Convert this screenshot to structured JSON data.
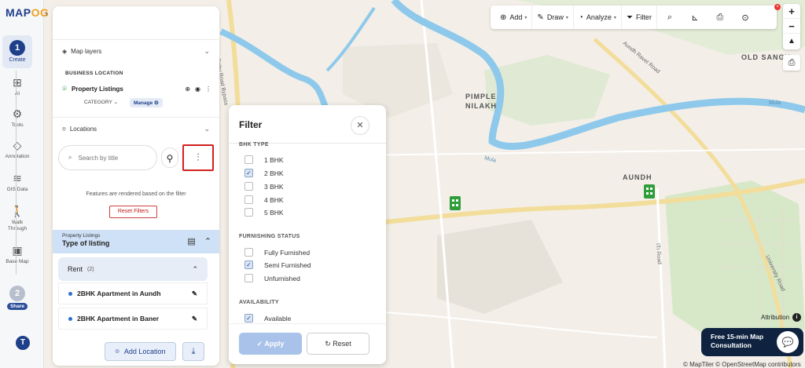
{
  "app": {
    "logo_text": "MAP",
    "logo_accent": "OG"
  },
  "rail": {
    "items": [
      {
        "label": "Create",
        "step": "1"
      },
      {
        "label": "AI"
      },
      {
        "label": "Tools"
      },
      {
        "label": "Annotation"
      },
      {
        "label": "GIS Data"
      },
      {
        "label": "Walk Through"
      },
      {
        "label": "Base Map"
      },
      {
        "label": "Share",
        "step": "2"
      }
    ],
    "avatar_initial": "T"
  },
  "panel": {
    "map_layers_label": "Map layers",
    "business_location_label": "BUSINESS LOCATION",
    "layer_name": "Property Listings",
    "category_label": "CATEGORY",
    "manage_label": "Manage",
    "locations_label": "Locations",
    "search_placeholder": "Search by title",
    "rendered_message": "Features are rendered based on the filter",
    "reset_filters_label": "Reset Filters",
    "group_small": "Property Listings",
    "group_title": "Type of listing",
    "rent_label": "Rent",
    "rent_count": "(2)",
    "listings": [
      "2BHK Apartment in Aundh",
      "2BHK Apartment in Baner"
    ],
    "add_location_label": "Add Location"
  },
  "filter": {
    "title": "Filter",
    "bhk_group": "BHK TYPE",
    "bhk_options": [
      {
        "label": "1 BHK",
        "checked": false
      },
      {
        "label": "2 BHK",
        "checked": true
      },
      {
        "label": "3 BHK",
        "checked": false
      },
      {
        "label": "4 BHK",
        "checked": false
      },
      {
        "label": "5 BHK",
        "checked": false
      }
    ],
    "furnishing_group": "FURNISHING STATUS",
    "furnishing_options": [
      {
        "label": "Fully Furnished",
        "checked": false
      },
      {
        "label": "Semi Furnished",
        "checked": true
      },
      {
        "label": "Unfurnished",
        "checked": false
      }
    ],
    "availability_group": "AVAILABILITY",
    "availability_options": [
      {
        "label": "Available",
        "checked": true
      }
    ],
    "apply_label": "Apply",
    "reset_label": "Reset"
  },
  "toolbar": {
    "add_label": "Add",
    "draw_label": "Draw",
    "analyze_label": "Analyze",
    "filter_label": "Filter"
  },
  "map": {
    "labels": [
      "PIMPLE",
      "NILAKH",
      "AUNDH",
      "OLD SANGV"
    ],
    "river_labels": [
      "Mula",
      "Mula"
    ],
    "road_labels": [
      "Katraj - Dehu Road Bypass",
      "Aundh Ravet Road",
      "ITI Road",
      "University Road"
    ],
    "attribution_label": "Attribution",
    "consult_text": "Free 15-min Map Consultation",
    "copyright": "© MapTiler © OpenStreetMap contributors",
    "colors": {
      "river": "#8ec9ec",
      "park": "#cfe6c0",
      "road_major": "#f6d98a",
      "marker": "#2e9d3a"
    }
  }
}
